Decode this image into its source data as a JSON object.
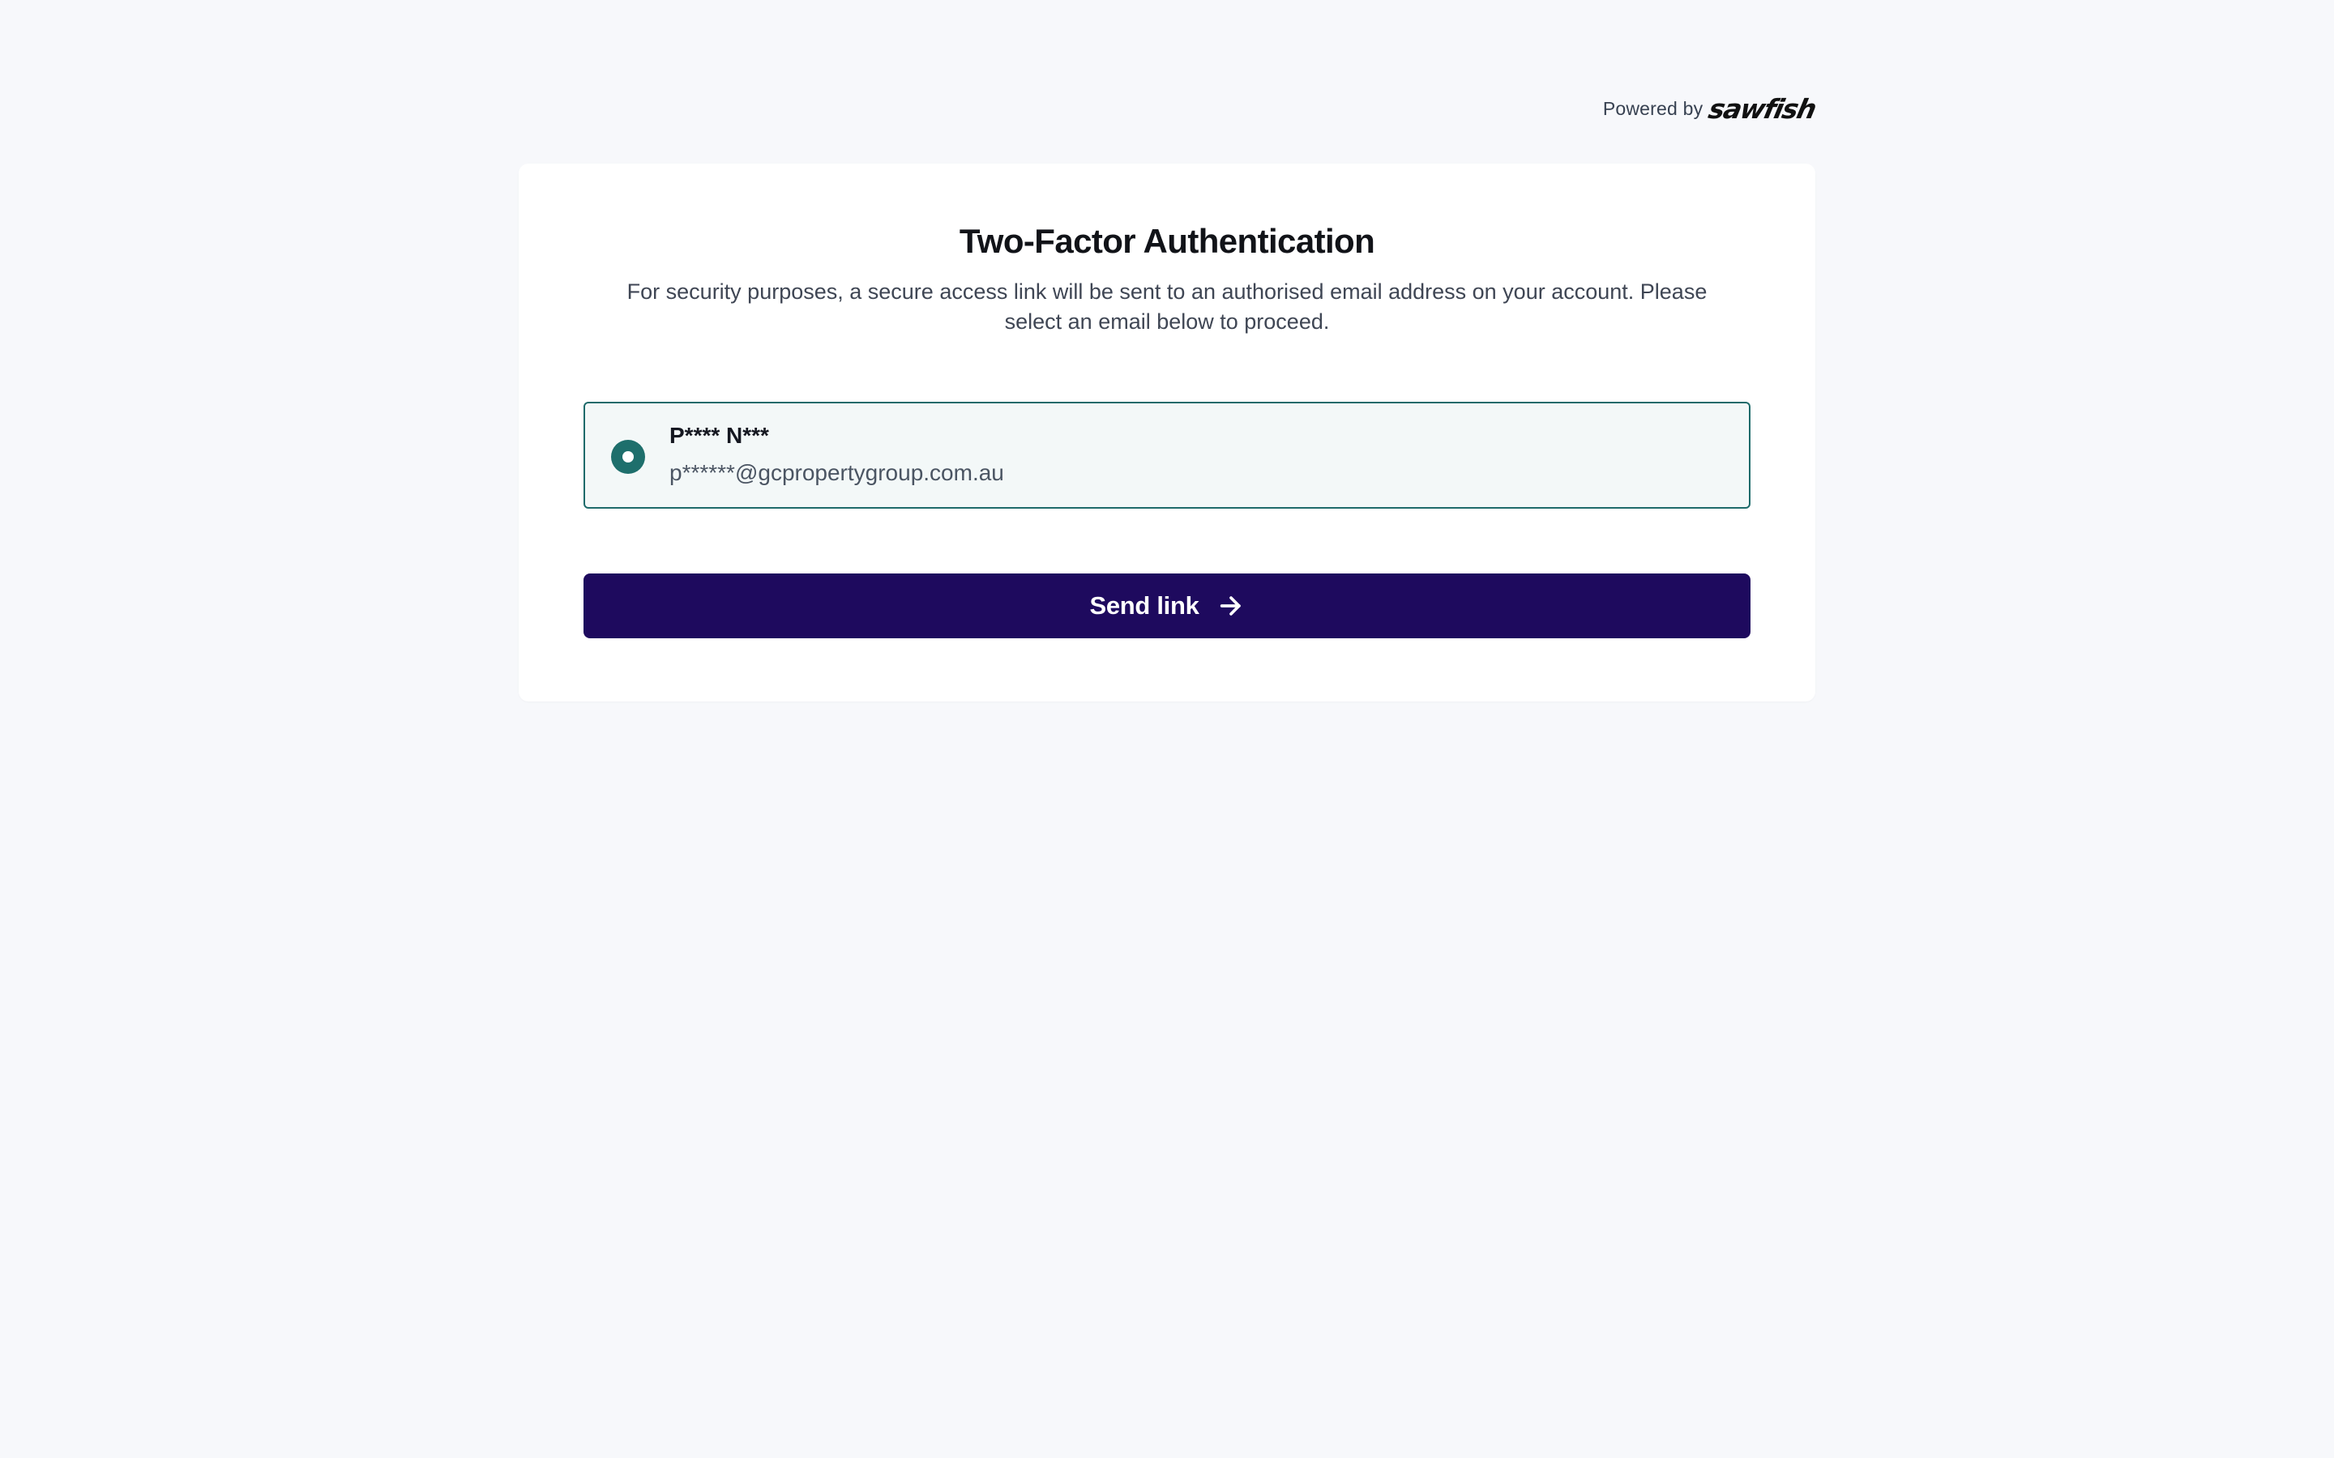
{
  "header": {
    "powered_by_label": "Powered by",
    "brand_logo": "sawfish"
  },
  "card": {
    "title": "Two-Factor Authentication",
    "description": "For security purposes, a secure access link will be sent to an authorised email address on your account. Please select an email below to proceed."
  },
  "email_options": [
    {
      "name": "P**** N***",
      "email": "p******@gcpropertygroup.com.au",
      "selected": true
    }
  ],
  "send_button": {
    "label": "Send link",
    "icon": "arrow-right-icon"
  },
  "colors": {
    "background": "#f7f8fb",
    "card": "#ffffff",
    "accent_teal": "#1e6f6c",
    "button": "#1e0a5e",
    "option_bg": "#f3f8f8"
  }
}
